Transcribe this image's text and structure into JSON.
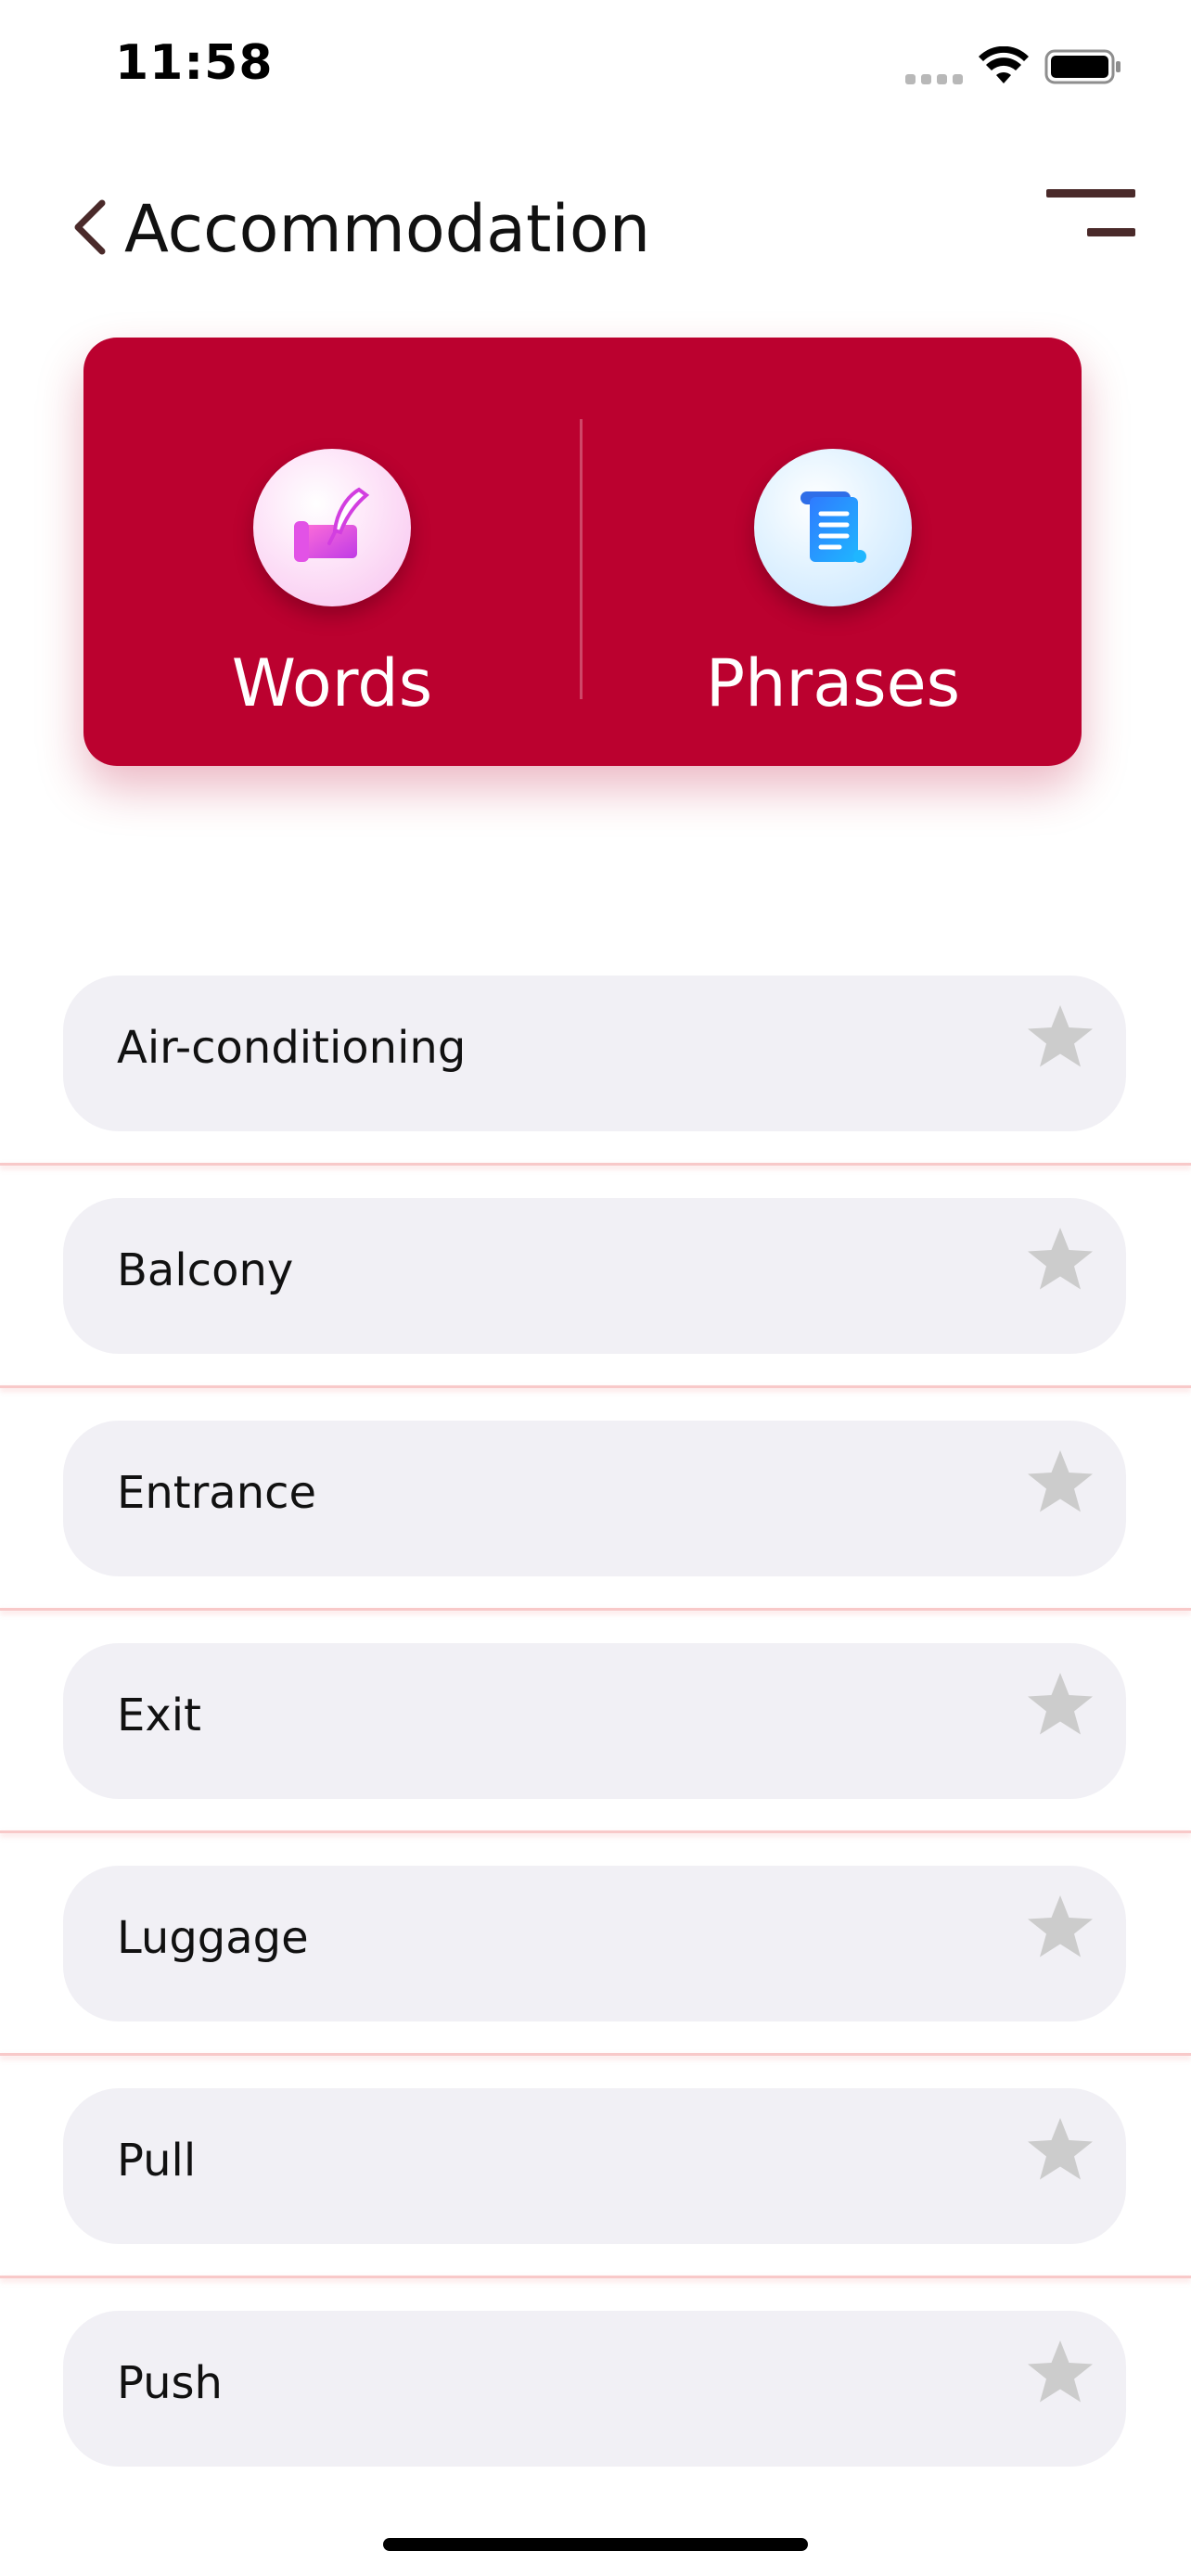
{
  "status_bar": {
    "time": "11:58"
  },
  "header": {
    "title": "Accommodation",
    "back_icon": "chevron-left-icon",
    "menu_icon": "menu-lines-icon"
  },
  "categories": {
    "words": {
      "label": "Words",
      "icon": "scroll-quill-icon"
    },
    "phrases": {
      "label": "Phrases",
      "icon": "document-scroll-icon"
    },
    "card_color": "#bb012f"
  },
  "words": [
    {
      "label": "Air-conditioning",
      "favorite": false
    },
    {
      "label": "Balcony",
      "favorite": false
    },
    {
      "label": "Entrance",
      "favorite": false
    },
    {
      "label": "Exit",
      "favorite": false
    },
    {
      "label": "Luggage",
      "favorite": false
    },
    {
      "label": "Pull",
      "favorite": false
    },
    {
      "label": "Push",
      "favorite": false
    }
  ],
  "colors": {
    "star_inactive": "#cccccc",
    "row_background": "#f1f0f5",
    "separator": "#f8c9c9"
  }
}
